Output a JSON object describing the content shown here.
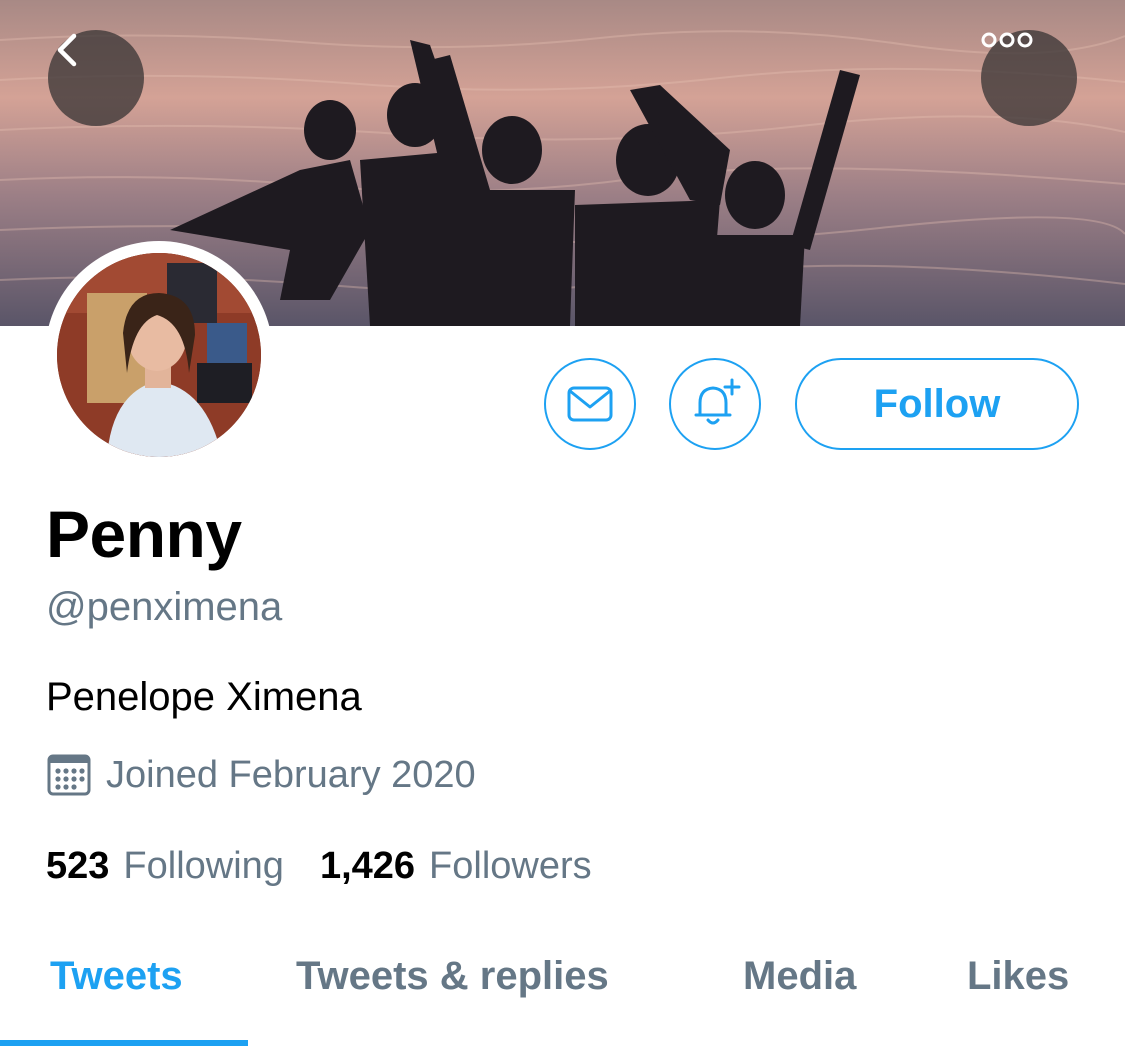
{
  "profile": {
    "display_name": "Penny",
    "handle": "@penximena",
    "bio": "Penelope Ximena",
    "joined": "Joined February 2020"
  },
  "stats": {
    "following_count": "523",
    "following_label": "Following",
    "followers_count": "1,426",
    "followers_label": "Followers"
  },
  "actions": {
    "follow_label": "Follow"
  },
  "tabs": [
    {
      "label": "Tweets",
      "active": true
    },
    {
      "label": "Tweets & replies",
      "active": false
    },
    {
      "label": "Media",
      "active": false
    },
    {
      "label": "Likes",
      "active": false
    }
  ],
  "icons": {
    "back": "chevron-left-icon",
    "more": "more-horizontal-icon",
    "message": "envelope-icon",
    "notify": "bell-plus-icon",
    "joined": "calendar-icon"
  },
  "colors": {
    "accent": "#1da1f2",
    "secondary_text": "#657786",
    "primary_text": "#000000"
  }
}
